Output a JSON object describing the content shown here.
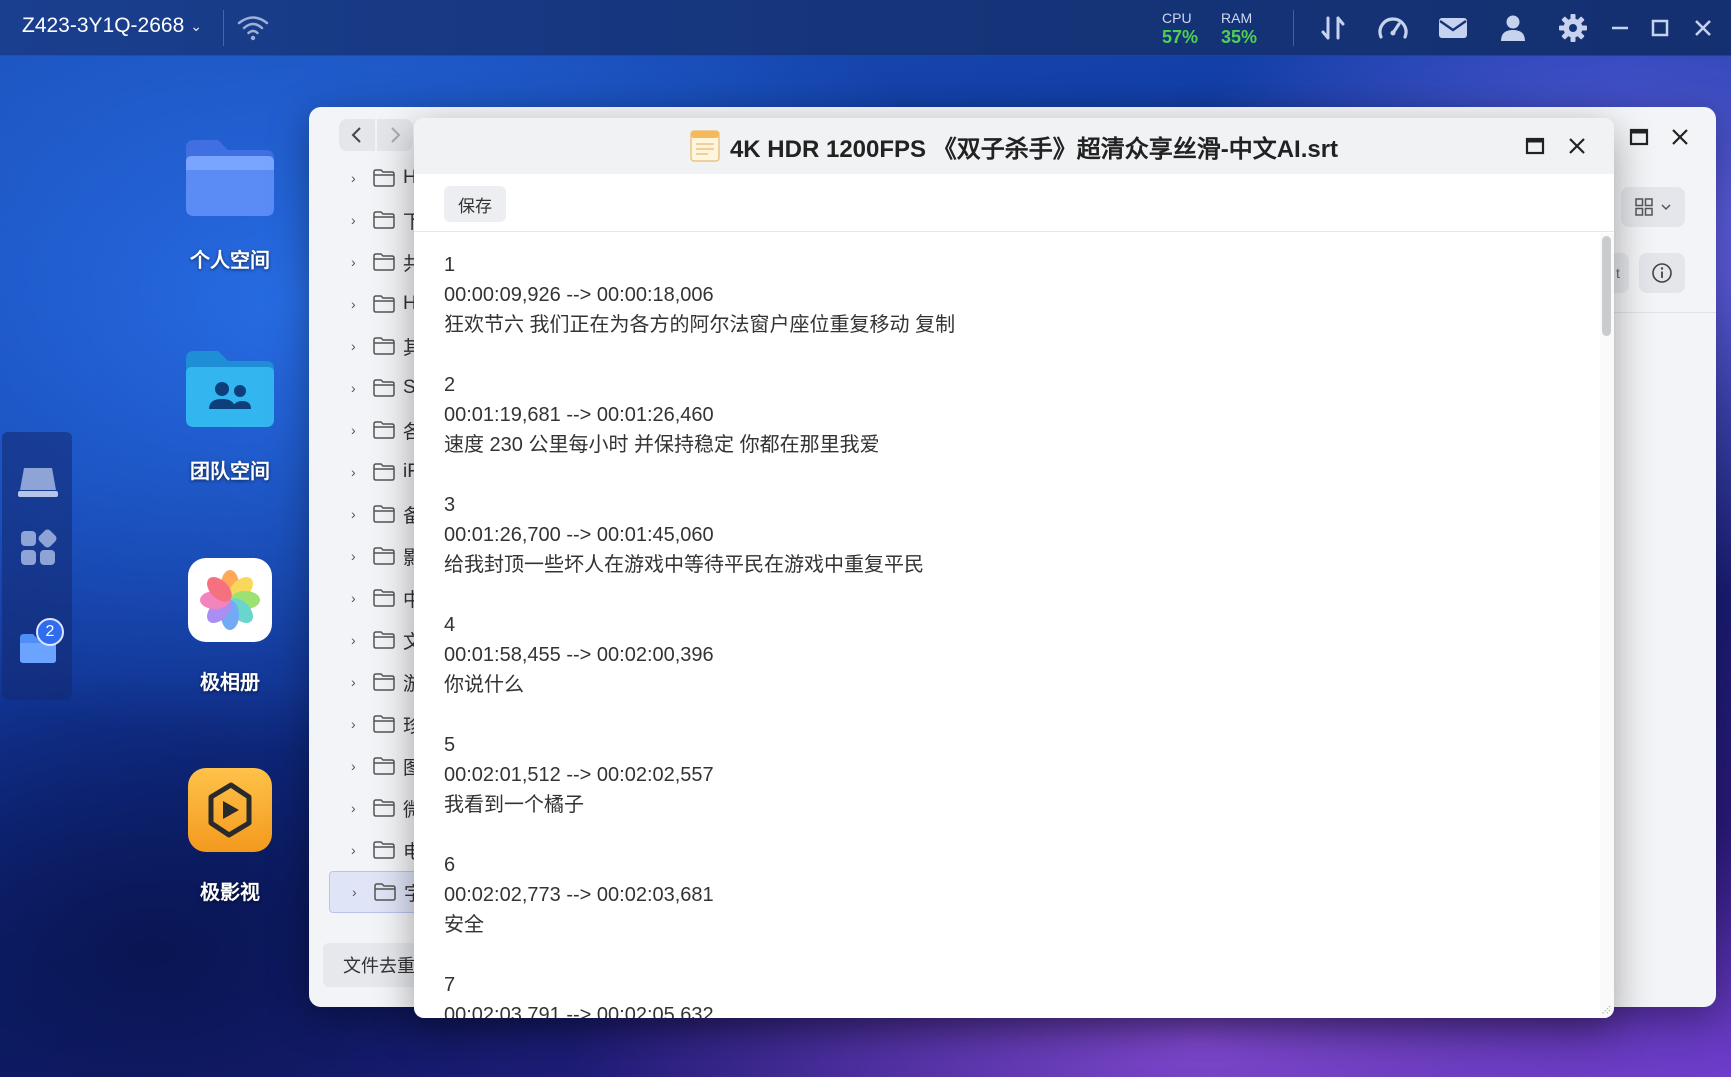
{
  "topbar": {
    "device_name": "Z423-3Y1Q-2668",
    "cpu_label": "CPU",
    "cpu_value": "57%",
    "ram_label": "RAM",
    "ram_value": "35%",
    "stat_color": "#4fd14f",
    "icons": [
      "transfer-icon",
      "speedometer-icon",
      "mail-icon",
      "user-icon",
      "gear-icon",
      "minimize-icon",
      "maximize-icon",
      "close-icon"
    ]
  },
  "dock": {
    "badge": "2",
    "items": [
      "desktop-icon",
      "apps-grid-icon",
      "folder-icon"
    ]
  },
  "desktop": {
    "icons": [
      {
        "label": "个人空间",
        "icon": "folder-icon"
      },
      {
        "label": "团队空间",
        "icon": "team-folder-icon"
      },
      {
        "label": "极相册",
        "icon": "photos-icon"
      },
      {
        "label": "极影视",
        "icon": "video-icon"
      }
    ]
  },
  "file_manager": {
    "tree": [
      {
        "name": "H"
      },
      {
        "name": "下"
      },
      {
        "name": "共"
      },
      {
        "name": "H"
      },
      {
        "name": "其"
      },
      {
        "name": "S"
      },
      {
        "name": "各"
      },
      {
        "name": "iF"
      },
      {
        "name": "备"
      },
      {
        "name": "影"
      },
      {
        "name": "中"
      },
      {
        "name": "文"
      },
      {
        "name": "游"
      },
      {
        "name": "珍"
      },
      {
        "name": "图"
      },
      {
        "name": "微"
      },
      {
        "name": "电"
      },
      {
        "name": "字"
      }
    ],
    "dedupe_label": "文件去重",
    "partial_button_text": "t"
  },
  "editor": {
    "filename": "4K HDR 1200FPS 《双子杀手》超清众享丝滑-中文AI.srt",
    "save_label": "保存",
    "entries": [
      {
        "index": "1",
        "time": "00:00:09,926 --> 00:00:18,006",
        "text": "狂欢节六 我们正在为各方的阿尔法窗户座位重复移动 复制"
      },
      {
        "index": "2",
        "time": "00:01:19,681 --> 00:01:26,460",
        "text": "速度 230 公里每小时 并保持稳定 你都在那里我爱"
      },
      {
        "index": "3",
        "time": "00:01:26,700 --> 00:01:45,060",
        "text": "给我封顶一些坏人在游戏中等待平民在游戏中重复平民"
      },
      {
        "index": "4",
        "time": "00:01:58,455 --> 00:02:00,396",
        "text": "你说什么"
      },
      {
        "index": "5",
        "time": "00:02:01,512 --> 00:02:02,557",
        "text": "我看到一个橘子"
      },
      {
        "index": "6",
        "time": "00:02:02,773 --> 00:02:03,681",
        "text": "安全"
      },
      {
        "index": "7",
        "time": "00:02:03,791 --> 00:02:05,632",
        "text": ""
      }
    ]
  }
}
